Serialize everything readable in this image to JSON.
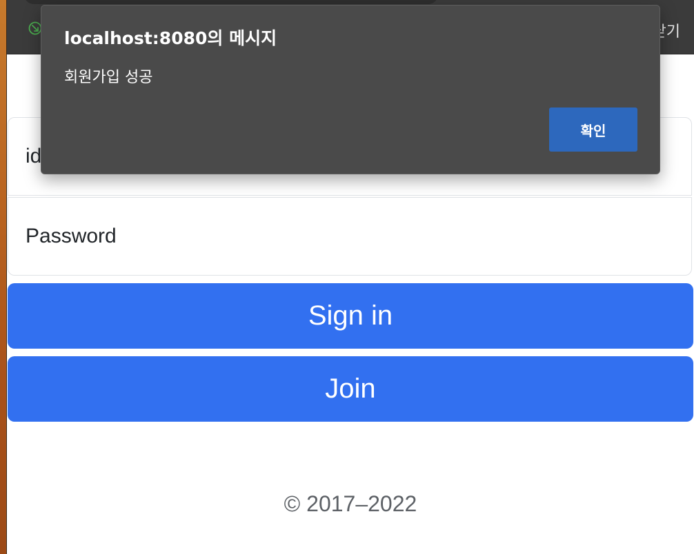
{
  "browser": {
    "right_text": "닫기",
    "icons": {
      "download": "download-icon"
    },
    "colors": {
      "bar": "#3b3b3b",
      "download_icon": "#4caf50"
    }
  },
  "form": {
    "id_placeholder": "id",
    "password_placeholder": "Password",
    "signin_label": "Sign in",
    "join_label": "Join",
    "footer": "© 2017–2022",
    "colors": {
      "primary": "#3270f0"
    }
  },
  "dialog": {
    "title": "localhost:8080의 메시지",
    "message": "회원가입 성공",
    "ok_label": "확인",
    "colors": {
      "background": "#4a4a4a",
      "ok_button": "#2d68bd"
    }
  }
}
